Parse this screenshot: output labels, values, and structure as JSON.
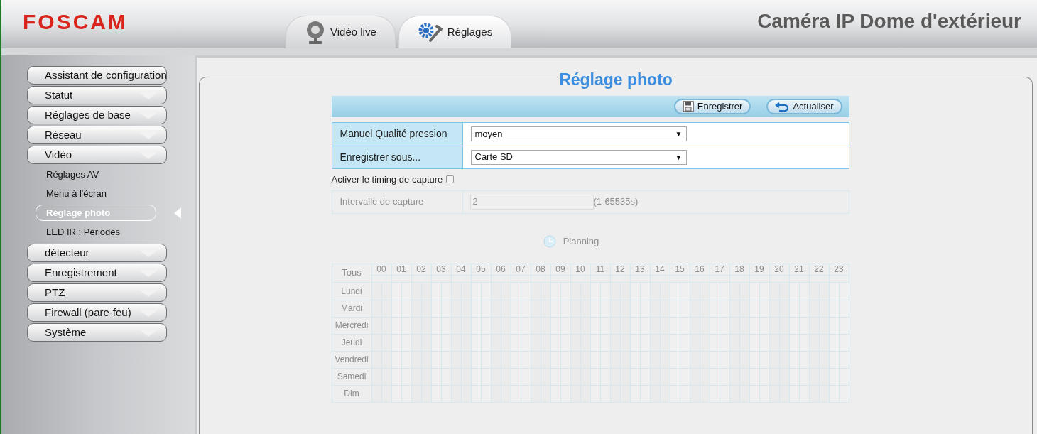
{
  "header": {
    "logo": "FOSCAM",
    "title": "Caméra IP Dome d'extérieur"
  },
  "tabs": [
    {
      "label": "Vidéo live",
      "selected": false
    },
    {
      "label": "Réglages",
      "selected": true
    }
  ],
  "sidebar": {
    "items": [
      {
        "label": "Assistant de configuration",
        "kind": "link"
      },
      {
        "label": "Statut",
        "kind": "group"
      },
      {
        "label": "Réglages de base",
        "kind": "group"
      },
      {
        "label": "Réseau",
        "kind": "group"
      },
      {
        "label": "Vidéo",
        "kind": "group",
        "children": [
          {
            "label": "Réglages AV",
            "selected": false
          },
          {
            "label": "Menu à l'écran",
            "selected": false
          },
          {
            "label": "Réglage photo",
            "selected": true
          },
          {
            "label": "LED IR : Périodes",
            "selected": false
          }
        ]
      },
      {
        "label": "détecteur",
        "kind": "group"
      },
      {
        "label": "Enregistrement",
        "kind": "group"
      },
      {
        "label": "PTZ",
        "kind": "group"
      },
      {
        "label": "Firewall (pare-feu)",
        "kind": "group"
      },
      {
        "label": "Système",
        "kind": "group"
      }
    ]
  },
  "panel": {
    "title": "Réglage photo",
    "toolbar": [
      {
        "label": "Enregistrer"
      },
      {
        "label": "Actualiser"
      }
    ],
    "fields": [
      {
        "label": "Manuel Qualité pression",
        "value": "moyen",
        "arrow": "▼"
      },
      {
        "label": "Enregistrer sous...",
        "value": "Carte SD",
        "arrow": "▼"
      }
    ],
    "capture_timing": {
      "label": "Activer le timing de capture",
      "checked": false
    },
    "interval": {
      "label": "Intervalle de capture",
      "value": "2",
      "hint": "(1-65535s)"
    },
    "planning": {
      "title": "Planning",
      "all_label": "Tous",
      "hours": [
        "00",
        "01",
        "02",
        "03",
        "04",
        "05",
        "06",
        "07",
        "08",
        "09",
        "10",
        "11",
        "12",
        "13",
        "14",
        "15",
        "16",
        "17",
        "18",
        "19",
        "20",
        "21",
        "22",
        "23"
      ],
      "days": [
        "Lundi",
        "Mardi",
        "Mercredi",
        "Jeudi",
        "Vendredi",
        "Samedi",
        "Dim"
      ]
    }
  }
}
